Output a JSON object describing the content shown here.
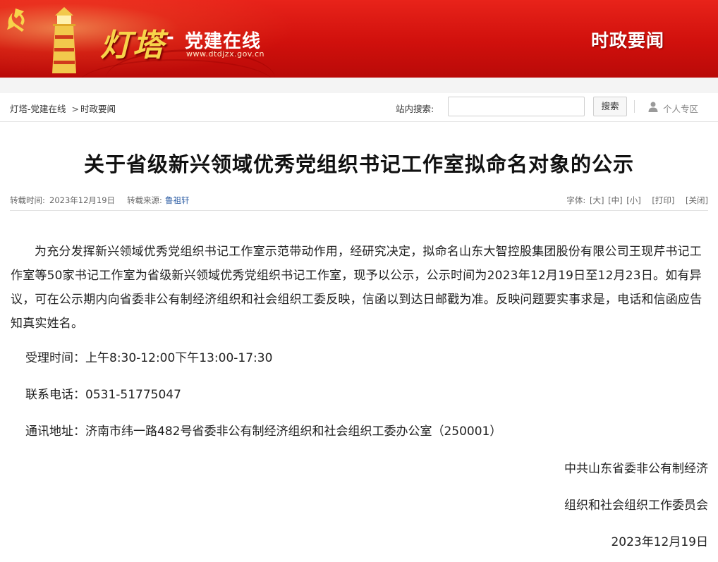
{
  "banner": {
    "logo_main": "灯塔",
    "logo_dash": "-",
    "logo_sub": "党建在线",
    "logo_url": "www.dtdjzx.gov.cn",
    "section_title": "时政要闻",
    "colors": {
      "banner_red": "#d0100c",
      "logo_gold": "#f7d44a"
    },
    "icons": [
      "party-emblem-icon",
      "lighthouse-icon"
    ]
  },
  "toolbar": {
    "breadcrumb": {
      "home": "灯塔-党建在线",
      "separator": ">",
      "current": "时政要闻"
    },
    "search_label": "站内搜索:",
    "search_value": "",
    "search_placeholder": "",
    "search_button": "搜索",
    "personal_link": "个人专区"
  },
  "article": {
    "title": "关于省级新兴领域优秀党组织书记工作室拟命名对象的公示",
    "meta": {
      "date_label": "转载时间:",
      "date": "2023年12月19日",
      "source_label": "转载来源:",
      "source": "鲁祖轩",
      "font_label": "字体:",
      "font_large": "[大]",
      "font_medium": "[中]",
      "font_small": "[小]",
      "print": "[打印]",
      "close": "[关闭]"
    },
    "body": "为充分发挥新兴领域优秀党组织书记工作室示范带动作用，经研究决定，拟命名山东大智控股集团股份有限公司王现芹书记工作室等50家书记工作室为省级新兴领域优秀党组织书记工作室，现予以公示，公示时间为2023年12月19日至12月23日。如有异议，可在公示期内向省委非公有制经济组织和社会组织工委反映，信函以到达日邮戳为准。反映问题要实事求是，电话和信函应告知真实姓名。",
    "hours": "受理时间：上午8:30-12:00下午13:00-17:30",
    "phone": "联系电话：0531-51775047",
    "address": "通讯地址：济南市纬一路482号省委非公有制经济组织和社会组织工委办公室（250001）",
    "signature_1": "中共山东省委非公有制经济",
    "signature_2": "组织和社会组织工作委员会",
    "signature_date": "2023年12月19日"
  }
}
